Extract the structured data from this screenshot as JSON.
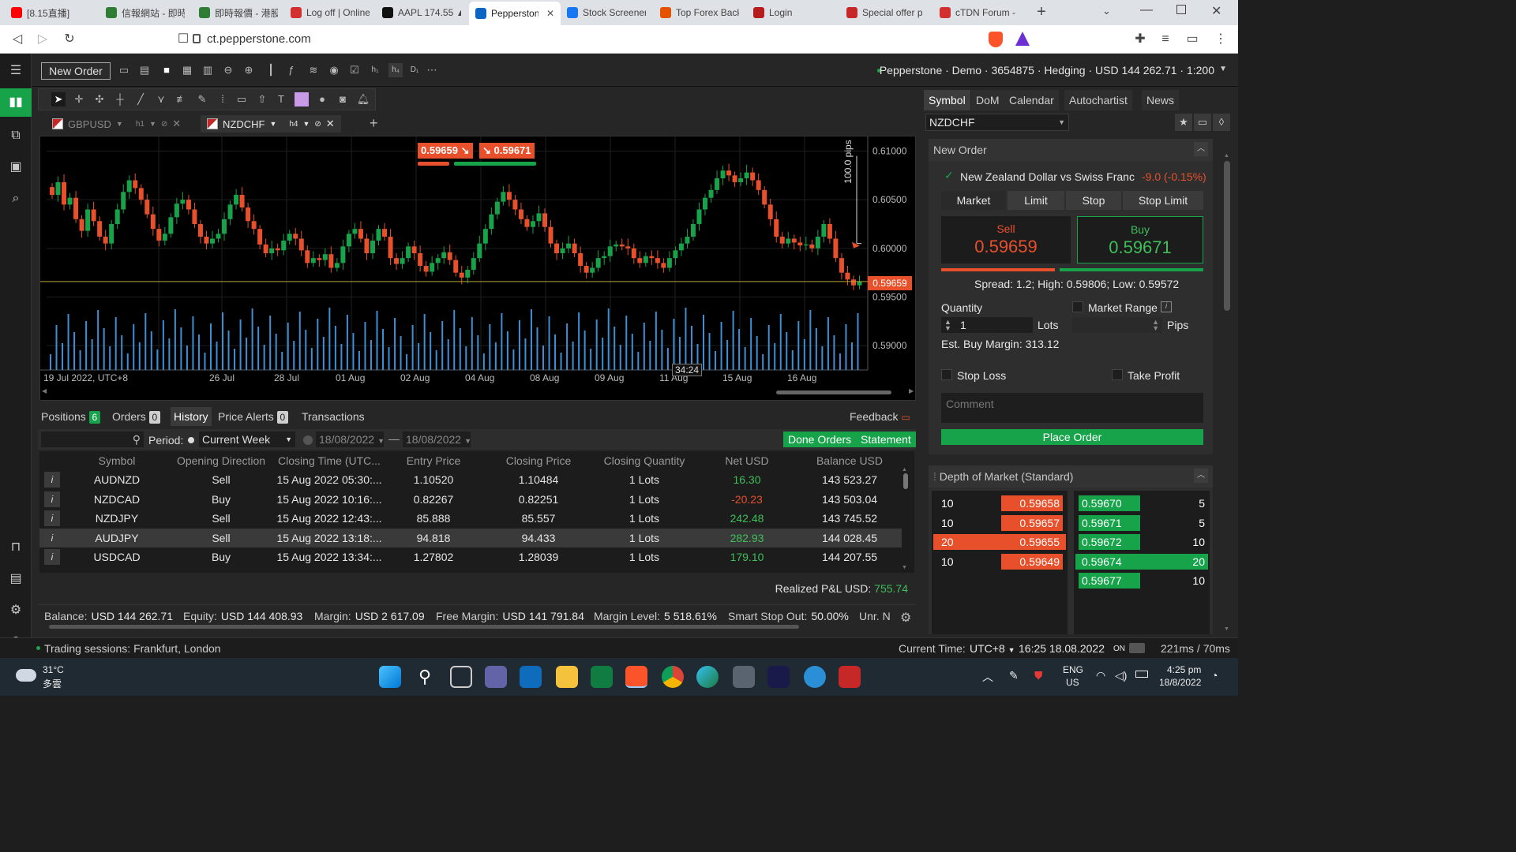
{
  "browser": {
    "tabs": [
      {
        "label": "[8.15直播]",
        "color": "#ff0000"
      },
      {
        "label": "信報網站 - 即時",
        "color": "#2e7d32"
      },
      {
        "label": "即時報價 - 港股",
        "color": "#2e7d32"
      },
      {
        "label": "Log off | Online",
        "color": "#d32f2f"
      },
      {
        "label": "AAPL 174.55 ▲",
        "color": "#111111"
      },
      {
        "label": "Pepperstone",
        "color": "#0a66c2"
      },
      {
        "label": "Stock Screener",
        "color": "#1877f2"
      },
      {
        "label": "Top Forex Back",
        "color": "#e65100"
      },
      {
        "label": "Login",
        "color": "#b71c1c"
      },
      {
        "label": "Special offer p",
        "color": "#c62828"
      },
      {
        "label": "cTDN Forum -",
        "color": "#d32f2f"
      }
    ],
    "url": "ct.pepperstone.com"
  },
  "toolbar": {
    "new_order": "New Order",
    "account": "Pepperstone · Demo · 3654875 · Hedging · USD 144 262.71 · 1:200"
  },
  "chart_tabs": [
    {
      "symbol": "GBPUSD",
      "timeframe": "h1"
    },
    {
      "symbol": "NZDCHF",
      "timeframe": "h4"
    }
  ],
  "chart": {
    "sell_price": "0.59659",
    "buy_price": "0.59671",
    "current_price_label": "0.59659",
    "pips_label": "100.0 pips",
    "countdown": "34:24",
    "x_labels": [
      "19 Jul 2022, UTC+8",
      "26 Jul",
      "28 Jul",
      "01 Aug",
      "02 Aug",
      "04 Aug",
      "08 Aug",
      "09 Aug",
      "11 Aug",
      "15 Aug",
      "16 Aug"
    ],
    "y_labels": [
      "0.61000",
      "0.60500",
      "0.60000",
      "0.59500",
      "0.59000"
    ]
  },
  "chart_data": {
    "type": "candlestick",
    "symbol": "NZDCHF",
    "timeframe": "h4",
    "y_range": [
      0.5875,
      0.6115
    ],
    "current": 0.59659,
    "closes": [
      0.6055,
      0.6068,
      0.6045,
      0.6052,
      0.603,
      0.6018,
      0.604,
      0.6028,
      0.6012,
      0.6005,
      0.6025,
      0.604,
      0.6058,
      0.607,
      0.6062,
      0.605,
      0.6035,
      0.602,
      0.6008,
      0.6015,
      0.6032,
      0.6046,
      0.605,
      0.604,
      0.6025,
      0.6012,
      0.6005,
      0.601,
      0.6015,
      0.603,
      0.6045,
      0.6055,
      0.6042,
      0.6028,
      0.602,
      0.6004,
      0.5995,
      0.6,
      0.5998,
      0.6008,
      0.6015,
      0.601,
      0.5998,
      0.5985,
      0.599,
      0.5988,
      0.5994,
      0.598,
      0.5985,
      0.6002,
      0.6015,
      0.602,
      0.601,
      0.5995,
      0.6008,
      0.602,
      0.6012,
      0.599,
      0.5984,
      0.599,
      0.6002,
      0.5995,
      0.5982,
      0.5976,
      0.5985,
      0.599,
      0.5996,
      0.5988,
      0.5975,
      0.597,
      0.5978,
      0.599,
      0.6005,
      0.602,
      0.6035,
      0.6048,
      0.6058,
      0.605,
      0.604,
      0.603,
      0.6022,
      0.6028,
      0.6036,
      0.6022,
      0.6005,
      0.5995,
      0.6,
      0.6005,
      0.5995,
      0.5982,
      0.5975,
      0.598,
      0.599,
      0.5992,
      0.6002,
      0.6004,
      0.6002,
      0.6,
      0.599,
      0.5985,
      0.5992,
      0.599,
      0.5985,
      0.598,
      0.599,
      0.5998,
      0.6005,
      0.6012,
      0.6025,
      0.604,
      0.6052,
      0.606,
      0.6072,
      0.608,
      0.6075,
      0.6068,
      0.6072,
      0.6078,
      0.607,
      0.606,
      0.6045,
      0.603,
      0.6012,
      0.6005,
      0.601,
      0.6006,
      0.6003,
      0.6004,
      0.6,
      0.6012,
      0.6025,
      0.601,
      0.599,
      0.5975,
      0.5968,
      0.5962,
      0.5966
    ]
  },
  "bottom_tabs": [
    {
      "label": "Positions",
      "count": "6"
    },
    {
      "label": "Orders",
      "count": "0"
    },
    {
      "label": "History",
      "count": ""
    },
    {
      "label": "Price Alerts",
      "count": "0"
    },
    {
      "label": "Transactions",
      "count": ""
    }
  ],
  "feedback": "Feedback",
  "filters": {
    "period_label": "Period:",
    "period_value": "Current Week",
    "date_from": "18/08/2022",
    "date_to": "18/08/2022",
    "done_orders": "Done Orders",
    "statement": "Statement"
  },
  "history": {
    "columns": [
      "Symbol",
      "Opening Direction",
      "Closing Time (UTC...",
      "Entry Price",
      "Closing Price",
      "Closing Quantity",
      "Net USD",
      "Balance USD"
    ],
    "rows": [
      {
        "symbol": "AUDNZD",
        "dir": "Sell",
        "time": "15 Aug 2022 05:30:...",
        "entry": "1.10520",
        "close": "1.10484",
        "qty": "1 Lots",
        "net": "16.30",
        "net_color": "#3fbf5a",
        "bal": "143 523.27"
      },
      {
        "symbol": "NZDCAD",
        "dir": "Buy",
        "time": "15 Aug 2022 10:16:...",
        "entry": "0.82267",
        "close": "0.82251",
        "qty": "1 Lots",
        "net": "-20.23",
        "net_color": "#e8502b",
        "bal": "143 503.04"
      },
      {
        "symbol": "NZDJPY",
        "dir": "Sell",
        "time": "15 Aug 2022 12:43:...",
        "entry": "85.888",
        "close": "85.557",
        "qty": "1 Lots",
        "net": "242.48",
        "net_color": "#3fbf5a",
        "bal": "143 745.52"
      },
      {
        "symbol": "AUDJPY",
        "dir": "Sell",
        "time": "15 Aug 2022 13:18:...",
        "entry": "94.818",
        "close": "94.433",
        "qty": "1 Lots",
        "net": "282.93",
        "net_color": "#3fbf5a",
        "bal": "144 028.45"
      },
      {
        "symbol": "USDCAD",
        "dir": "Buy",
        "time": "15 Aug 2022 13:34:...",
        "entry": "1.27802",
        "close": "1.28039",
        "qty": "1 Lots",
        "net": "179.10",
        "net_color": "#3fbf5a",
        "bal": "144 207.55"
      }
    ]
  },
  "pnl": {
    "label": "Realized P&L USD:",
    "value": "755.74"
  },
  "status": [
    {
      "label": "Balance:",
      "value": "USD 144 262.71"
    },
    {
      "label": "Equity:",
      "value": "USD 144 408.93"
    },
    {
      "label": "Margin:",
      "value": "USD 2 617.09"
    },
    {
      "label": "Free Margin:",
      "value": "USD 141 791.84"
    },
    {
      "label": "Margin Level:",
      "value": "5 518.61%"
    },
    {
      "label": "Smart Stop Out:",
      "value": "50.00%"
    },
    {
      "label": "Unr. N",
      "value": ""
    }
  ],
  "sessions": {
    "text": "Trading sessions: Frankfurt, London",
    "time_label": "Current Time:",
    "tz": "UTC+8",
    "time": "16:25 18.08.2022",
    "on": "ON",
    "latency": "221ms / 70ms"
  },
  "right": {
    "tabs": [
      "Symbol",
      "DoM",
      "Calendar",
      "Autochartist",
      "News"
    ],
    "symbol": "NZDCHF",
    "new_order_title": "New Order",
    "instrument": "New Zealand Dollar vs Swiss Franc",
    "change": "-9.0 (-0.15%)",
    "order_types": [
      "Market",
      "Limit",
      "Stop",
      "Stop Limit"
    ],
    "sell_label": "Sell",
    "sell_price": "0.59659",
    "buy_label": "Buy",
    "buy_price": "0.59671",
    "spread": "Spread: 1.2; High: 0.59806; Low: 0.59572",
    "quantity_label": "Quantity",
    "quantity": "1",
    "lots": "Lots",
    "market_range": "Market Range",
    "pips": "Pips",
    "est_margin": "Est. Buy Margin: 313.12",
    "stop_loss": "Stop Loss",
    "take_profit": "Take Profit",
    "comment_placeholder": "Comment",
    "place_order": "Place Order",
    "depth_title": "Depth of Market (Standard)",
    "bids": [
      {
        "vol": "10",
        "price": "0.59658"
      },
      {
        "vol": "10",
        "price": "0.59657"
      },
      {
        "vol": "20",
        "price": "0.59655"
      },
      {
        "vol": "10",
        "price": "0.59649"
      }
    ],
    "asks": [
      {
        "price": "0.59670",
        "vol": "5"
      },
      {
        "price": "0.59671",
        "vol": "5"
      },
      {
        "price": "0.59672",
        "vol": "10"
      },
      {
        "price": "0.59674",
        "vol": "20"
      },
      {
        "price": "0.59677",
        "vol": "10"
      }
    ]
  },
  "taskbar": {
    "weather_temp": "31°C",
    "weather_desc": "多雲",
    "lang1": "ENG",
    "lang2": "US",
    "clock_time": "4:25 pm",
    "clock_date": "18/8/2022"
  }
}
